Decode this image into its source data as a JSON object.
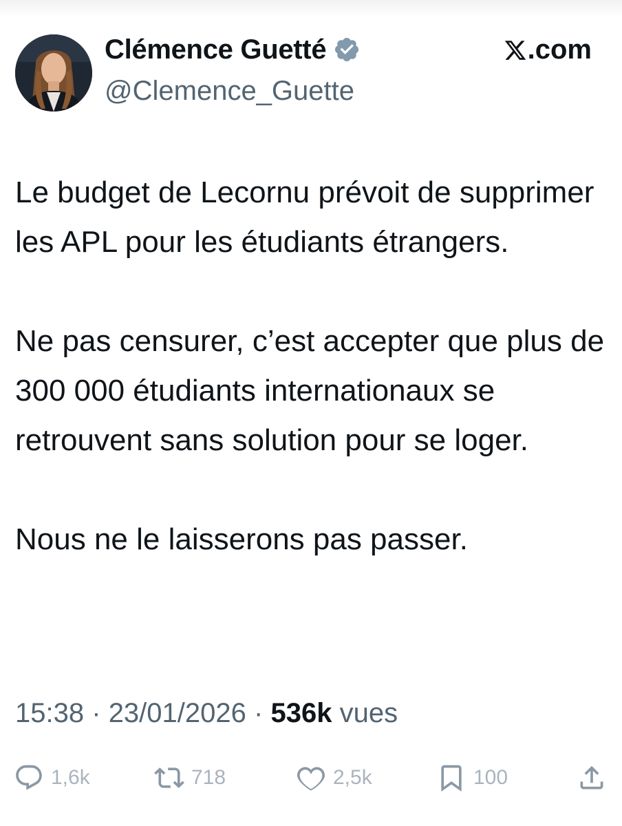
{
  "author": {
    "display_name": "Clémence Guetté",
    "handle": "@Clemence_Guette",
    "verified": true,
    "avatar_description_icon": "profile-photo"
  },
  "brand": {
    "label": ".com",
    "logo_icon": "x-logo-icon"
  },
  "tweet": {
    "paragraphs": [
      "Le budget de Lecornu prévoit de supprimer les APL pour les étudiants étrangers.",
      "Ne pas censurer, c’est accepter que plus de 300 000 étudiants internationaux se retrouvent sans solution pour se loger.",
      "Nous ne le laisserons pas passer."
    ]
  },
  "meta": {
    "time": "15:38",
    "separator": "·",
    "date": "23/01/2026",
    "views_count": "536k",
    "views_label": "vues"
  },
  "actions": {
    "replies": {
      "icon": "reply-icon",
      "count": "1,6k"
    },
    "reposts": {
      "icon": "repost-icon",
      "count": "718"
    },
    "likes": {
      "icon": "heart-icon",
      "count": "2,5k"
    },
    "bookmarks": {
      "icon": "bookmark-icon",
      "count": "100"
    },
    "share": {
      "icon": "share-icon"
    }
  },
  "colors": {
    "text": "#0f1419",
    "secondary": "#536471",
    "action_gray": "#8b98a5",
    "verified_badge": "#829aab"
  }
}
